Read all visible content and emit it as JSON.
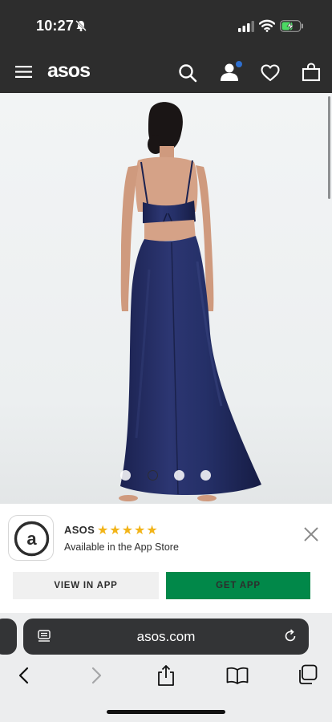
{
  "status_bar": {
    "time": "10:27"
  },
  "header": {
    "brand": "asos"
  },
  "product": {
    "image_description_icon": "product-photo",
    "carousel_dots": 4,
    "active_dot": 2
  },
  "app_banner": {
    "app_name": "ASOS",
    "rating": "★★★★★",
    "subtitle": "Available in the App Store",
    "view_label": "VIEW IN APP",
    "get_label": "GET APP"
  },
  "browser": {
    "url": "asos.com"
  },
  "colors": {
    "header_bg": "#2d2d2d",
    "get_app_green": "#018849",
    "notification_dot": "#2e6fcf",
    "star_color": "#f2b418"
  }
}
